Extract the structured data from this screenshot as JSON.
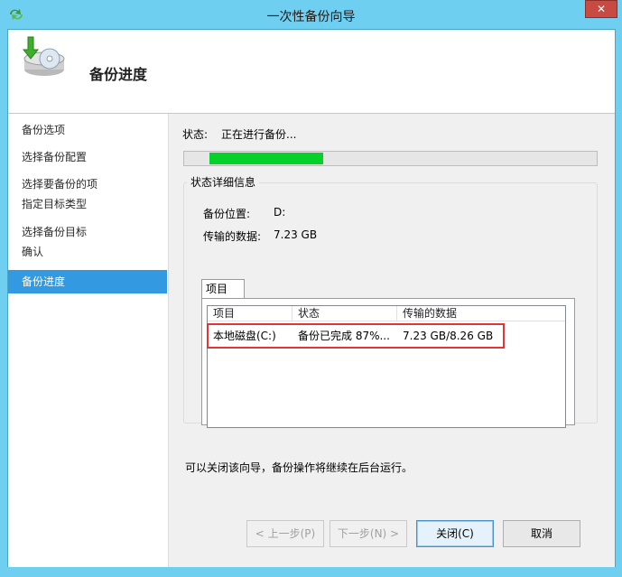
{
  "window": {
    "title": "一次性备份向导",
    "close_label": "✕"
  },
  "header": {
    "title": "备份进度"
  },
  "sidebar": {
    "items": [
      {
        "label": "备份选项"
      },
      {
        "label": "选择备份配置"
      },
      {
        "label": "选择要备份的项"
      },
      {
        "label": "指定目标类型"
      },
      {
        "label": "选择备份目标"
      },
      {
        "label": "确认"
      },
      {
        "label": "备份进度",
        "selected": true
      }
    ]
  },
  "status": {
    "label": "状态:",
    "value": "正在进行备份...",
    "progress_fraction": 0.87
  },
  "details": {
    "legend": "状态详细信息",
    "location_label": "备份位置:",
    "location_value": "D:",
    "transferred_label": "传输的数据:",
    "transferred_value": "7.23 GB",
    "tab_label": "项目",
    "columns": [
      "项目",
      "状态",
      "传输的数据"
    ],
    "rows": [
      {
        "item": "本地磁盘(C:)",
        "status": "备份已完成 87%...",
        "data": "7.23 GB/8.26 GB"
      }
    ]
  },
  "note": "可以关闭该向导，备份操作将继续在后台运行。",
  "buttons": {
    "prev": "< 上一步(P)",
    "next": "下一步(N) >",
    "close": "关闭(C)",
    "cancel": "取消"
  },
  "colors": {
    "progress": "#06d02a",
    "selected": "#3399e0",
    "highlight": "#e23636"
  }
}
